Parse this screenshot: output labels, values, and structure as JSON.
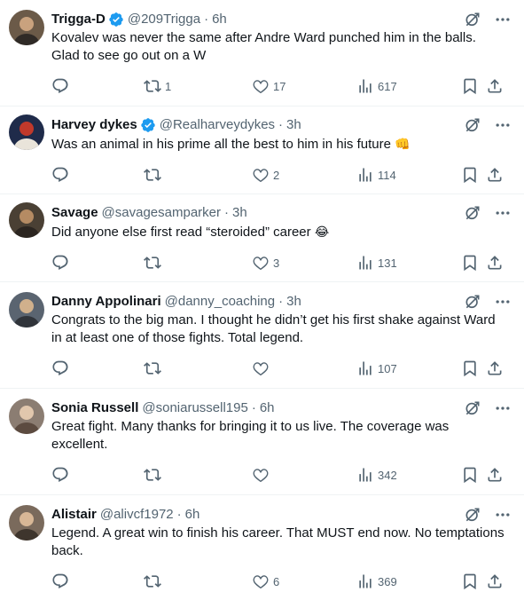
{
  "tweets": [
    {
      "name": "Trigga-D",
      "verified": true,
      "handle": "@209Trigga",
      "time": "6h",
      "text": "Kovalev was never the same after Andre Ward punched him in the balls. Glad to see go out on a W",
      "emoji": "",
      "replies": "",
      "retweets": "1",
      "likes": "17",
      "views": "617",
      "avatar_colors": [
        "#6b5a48",
        "#c9a27e",
        "#2f2a26"
      ]
    },
    {
      "name": "Harvey dykes",
      "verified": true,
      "handle": "@Realharveydykes",
      "time": "3h",
      "text": "Was an animal in his prime all the best to him in his future",
      "emoji": "👊",
      "replies": "",
      "retweets": "",
      "likes": "2",
      "views": "114",
      "avatar_colors": [
        "#1f2b4a",
        "#c0392b",
        "#e9e4da"
      ]
    },
    {
      "name": "Savage",
      "verified": false,
      "handle": "@savagesamparker",
      "time": "3h",
      "text": "Did anyone else first read “steroided” career",
      "emoji": "😂",
      "replies": "",
      "retweets": "",
      "likes": "3",
      "views": "131",
      "avatar_colors": [
        "#4a4034",
        "#b58b63",
        "#2b2520"
      ]
    },
    {
      "name": "Danny Appolinari",
      "verified": false,
      "handle": "@danny_coaching",
      "time": "3h",
      "text": "Congrats to the big man. I thought he didn’t get his first shake against Ward in at least one of those fights. Total legend.",
      "emoji": "",
      "replies": "",
      "retweets": "",
      "likes": "",
      "views": "107",
      "avatar_colors": [
        "#5a6470",
        "#d0b08c",
        "#30343a"
      ]
    },
    {
      "name": "Sonia Russell",
      "verified": false,
      "handle": "@soniarussell195",
      "time": "6h",
      "text": "Great fight. Many thanks for bringing it to us live. The coverage was excellent.",
      "emoji": "",
      "replies": "",
      "retweets": "",
      "likes": "",
      "views": "342",
      "avatar_colors": [
        "#8b7d72",
        "#e1c7ad",
        "#5c4b40"
      ]
    },
    {
      "name": "Alistair",
      "verified": false,
      "handle": "@alivcf1972",
      "time": "6h",
      "text": "Legend. A great win to finish his career. That MUST end now. No temptations back.",
      "emoji": "",
      "replies": "",
      "retweets": "",
      "likes": "6",
      "views": "369",
      "avatar_colors": [
        "#7a6a5c",
        "#d8b796",
        "#3e352d"
      ]
    }
  ],
  "colors": {
    "text": "#0f1419",
    "secondary": "#536471",
    "verified": "#1d9bf0",
    "divider": "#eff3f4"
  },
  "icons": [
    "reply-icon",
    "retweet-icon",
    "like-icon",
    "views-icon",
    "bookmark-icon",
    "share-icon",
    "grok-icon",
    "more-icon",
    "verified-badge-icon"
  ]
}
